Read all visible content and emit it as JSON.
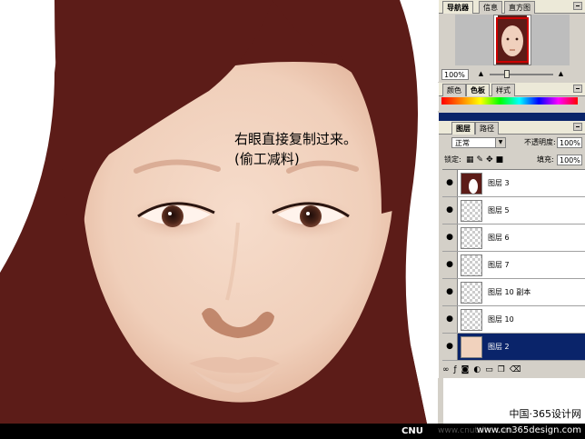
{
  "canvas": {
    "annotation_line1": "右眼直接复制过来。",
    "annotation_line2": "(偷工减料)"
  },
  "navigator": {
    "tabs": [
      "导航器",
      "信息",
      "直方图"
    ],
    "zoom": "100%"
  },
  "color_panel": {
    "tabs": [
      "颜色",
      "色板",
      "样式"
    ]
  },
  "layers_panel": {
    "tabs": [
      "图层",
      "路径"
    ],
    "blend_mode": "正常",
    "opacity_label": "不透明度:",
    "opacity_value": "100%",
    "lock_label": "锁定:",
    "fill_label": "填充:",
    "fill_value": "100%",
    "layers": [
      {
        "name": "图层 3",
        "thumb": "hair",
        "selected": false
      },
      {
        "name": "图层 5",
        "thumb": "transparent",
        "selected": false
      },
      {
        "name": "图层 6",
        "thumb": "transparent",
        "selected": false
      },
      {
        "name": "图层 7",
        "thumb": "transparent",
        "selected": false
      },
      {
        "name": "图层 10 副本",
        "thumb": "transparent",
        "selected": false
      },
      {
        "name": "图层 10",
        "thumb": "transparent",
        "selected": false
      },
      {
        "name": "图层 2",
        "thumb": "face",
        "selected": true
      }
    ]
  },
  "footer": {
    "brand": "CNU",
    "url": "www.cnutsite.com",
    "watermark_line1": "中国·365设计网",
    "watermark_line2": "www.cn365design.com"
  },
  "colors": {
    "hair": "#5c1c18",
    "skin": "#f0d0bd",
    "panel": "#d4d0c8",
    "selection": "#0a246a"
  }
}
